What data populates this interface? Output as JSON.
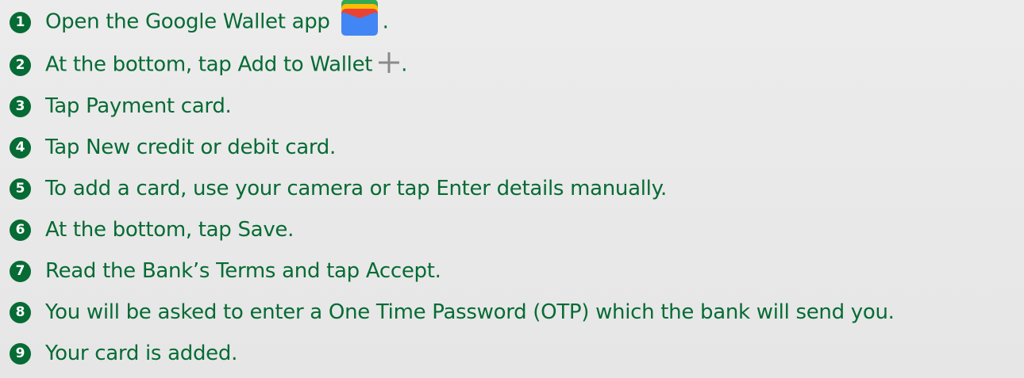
{
  "steps": [
    {
      "number": "1",
      "text": "Open the Google Wallet app",
      "suffix": ".",
      "icon": "google-wallet-icon"
    },
    {
      "number": "2",
      "text": "At the bottom, tap Add to Wallet",
      "suffix": ".",
      "icon": "plus-icon"
    },
    {
      "number": "3",
      "text": "Tap Payment card."
    },
    {
      "number": "4",
      "text": "Tap New credit or debit card."
    },
    {
      "number": "5",
      "text": "To add a card, use your camera or tap Enter details manually."
    },
    {
      "number": "6",
      "text": "At the bottom, tap Save."
    },
    {
      "number": "7",
      "text": "Read the Bank’s Terms and tap Accept."
    },
    {
      "number": "8",
      "text": "You will be asked to enter a One Time Password (OTP) which the bank will send you."
    },
    {
      "number": "9",
      "text": "Your card is added."
    }
  ],
  "colors": {
    "text": "#066b34",
    "number_badge": "#066b34",
    "background": "#e9e9e9",
    "plus_icon": "#8a8a8a",
    "wallet_green": "#34a853",
    "wallet_yellow": "#fbbc04",
    "wallet_red": "#ea4335",
    "wallet_blue": "#4285f4"
  }
}
